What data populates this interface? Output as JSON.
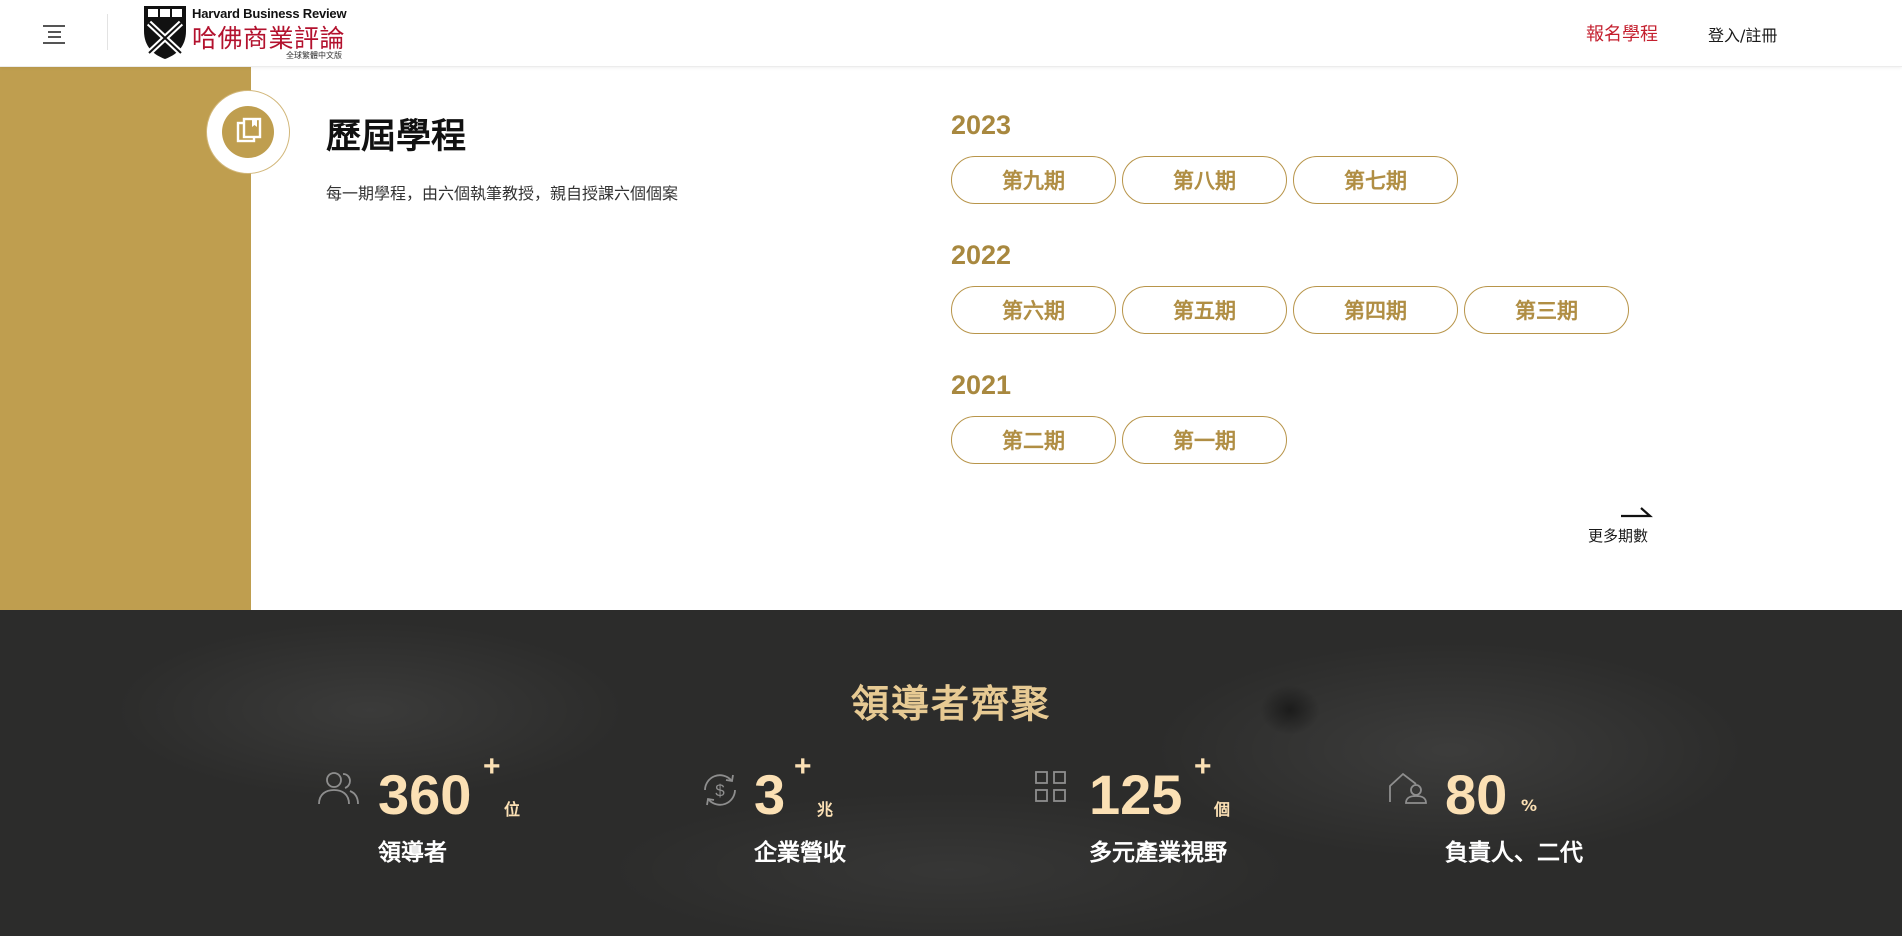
{
  "header": {
    "logo_en": "Harvard Business Review",
    "logo_zh": "哈佛商業評論",
    "logo_sub": "全球繁體中文版",
    "enroll_label": "報名學程",
    "login_label": "登入/註冊"
  },
  "section": {
    "title": "歷屆學程",
    "description": "每一期學程，由六個執筆教授，親自授課六個個案"
  },
  "terms": [
    {
      "year": "2023",
      "items": [
        "第九期",
        "第八期",
        "第七期"
      ]
    },
    {
      "year": "2022",
      "items": [
        "第六期",
        "第五期",
        "第四期",
        "第三期"
      ]
    },
    {
      "year": "2021",
      "items": [
        "第二期",
        "第一期"
      ]
    }
  ],
  "more_label": "更多期數",
  "leaders": {
    "title": "領導者齊聚",
    "stats": [
      {
        "icon": "people-icon",
        "number": "360",
        "plus": "+",
        "unit": "位",
        "label": "領導者"
      },
      {
        "icon": "dollar-cycle-icon",
        "number": "3",
        "plus": "+",
        "unit": "兆",
        "label": "企業營收"
      },
      {
        "icon": "grid-icon",
        "number": "125",
        "plus": "+",
        "unit": "個",
        "label": "多元產業視野"
      },
      {
        "icon": "house-person-icon",
        "number": "80",
        "plus": "",
        "unit": "%",
        "label": "負責人、二代"
      }
    ]
  },
  "colors": {
    "gold": "#bf9e4f",
    "gold_text": "#b08e44",
    "brand_red": "#b3122e",
    "dark_bg": "#2c2c2b",
    "stat_number": "#fbe0b4"
  }
}
